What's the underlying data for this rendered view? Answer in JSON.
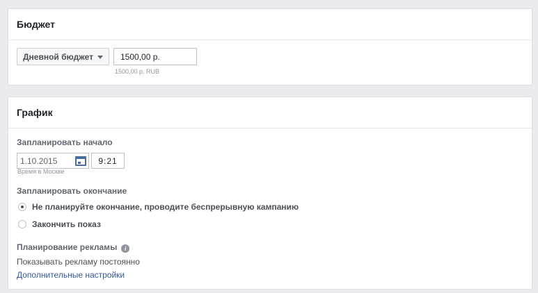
{
  "budget": {
    "title": "Бюджет",
    "type_label": "Дневной бюджет",
    "amount_value": "1500,00 р.",
    "amount_hint": "1500,00 р. RUB"
  },
  "schedule": {
    "title": "График",
    "start_label": "Запланировать начало",
    "start_date": "1.10.2015",
    "start_time": "9:21",
    "timezone_hint": "Время в Москве",
    "end_label": "Запланировать окончание",
    "end_options": [
      {
        "label": "Не планируйте окончание, проводите беспрерывную кампанию",
        "selected": true
      },
      {
        "label": "Закончить показ",
        "selected": false
      }
    ],
    "ad_scheduling_label": "Планирование рекламы",
    "ad_scheduling_value": "Показывать рекламу постоянно",
    "advanced_link": "Дополнительные настройки"
  },
  "icons": {
    "dropdown": "chevron-down-icon",
    "calendar": "calendar-icon",
    "info": "info-icon"
  },
  "colors": {
    "link": "#365899",
    "background": "#e9ebee",
    "border": "#dddfe2"
  }
}
